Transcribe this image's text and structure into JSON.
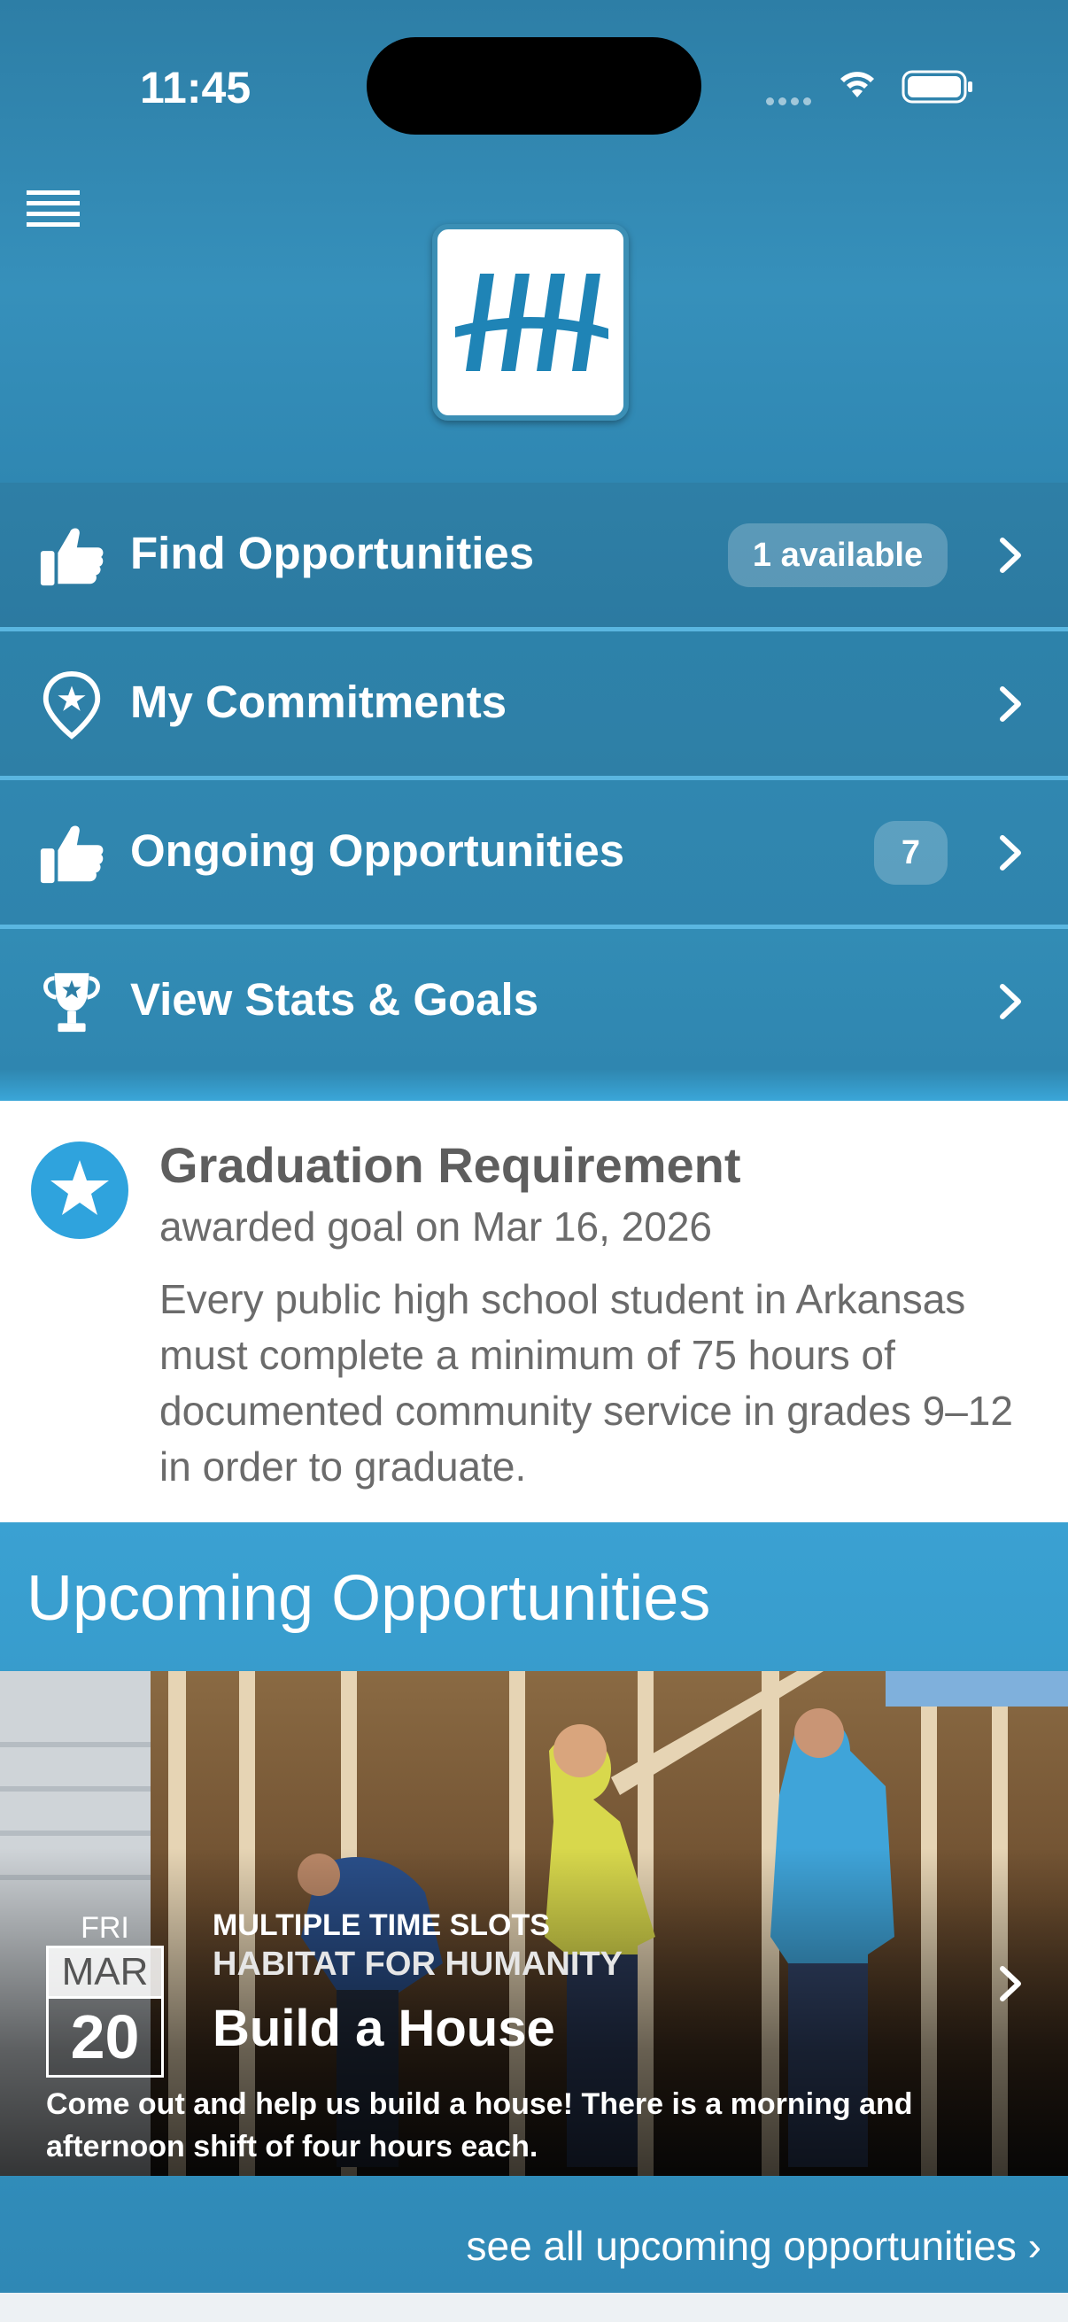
{
  "status_bar": {
    "time": "11:45"
  },
  "menu": {
    "items": [
      {
        "label": "Find Opportunities",
        "badge": "1 available",
        "icon": "thumbs-up-icon"
      },
      {
        "label": "My Commitments",
        "badge": "",
        "icon": "map-pin-star-icon"
      },
      {
        "label": "Ongoing Opportunities",
        "badge": "7",
        "icon": "thumbs-up-icon"
      },
      {
        "label": "View Stats & Goals",
        "badge": "",
        "icon": "trophy-icon"
      }
    ]
  },
  "goal": {
    "title": "Graduation Requirement",
    "subtitle": "awarded goal on Mar 16, 2026",
    "description": "Every public high school student in Arkansas must complete a minimum of 75 hours of documented community service in grades 9–12 in order to graduate."
  },
  "upcoming": {
    "title": "Upcoming Opportunities",
    "event": {
      "day_of_week": "FRI",
      "month": "MAR",
      "day": "20",
      "slots": "MULTIPLE TIME SLOTS",
      "organization": "HABITAT FOR HUMANITY",
      "title": "Build a House",
      "description": "Come out and help us build a house! There is a morning and afternoon shift of four hours each."
    },
    "see_all": "see all upcoming opportunities ›"
  },
  "colors": {
    "primary": "#2e7fa6",
    "accent": "#2fa3dd",
    "divider": "#5ab6e0"
  }
}
